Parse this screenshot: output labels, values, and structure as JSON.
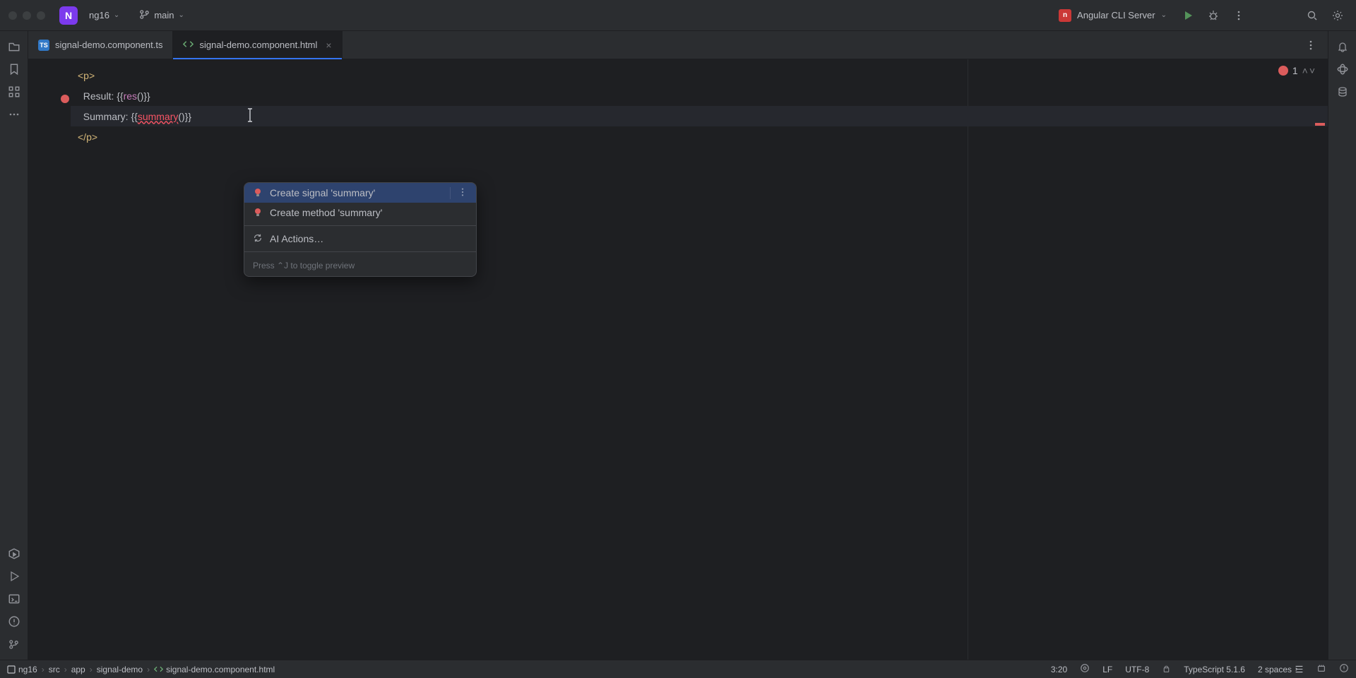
{
  "titlebar": {
    "project_letter": "N",
    "project_name": "ng16",
    "branch_name": "main",
    "run_config": "Angular CLI Server"
  },
  "tabs": [
    {
      "label": "signal-demo.component.ts",
      "type": "ts"
    },
    {
      "label": "signal-demo.component.html",
      "type": "html",
      "active": true
    }
  ],
  "code": {
    "line1_open": "<p>",
    "line2_prefix": "  Result: {{",
    "line2_fn": "res",
    "line2_suffix": "()}}",
    "line3_prefix": "  Summary: {{",
    "line3_fn": "summary",
    "line3_suffix": "()}}",
    "line4_close": "</p>"
  },
  "inspections": {
    "error_count": "1"
  },
  "intentions": {
    "items": [
      {
        "label": "Create signal 'summary'",
        "icon": "bulb-red",
        "selected": true
      },
      {
        "label": "Create method 'summary'",
        "icon": "bulb-red"
      }
    ],
    "ai_label": "AI Actions…",
    "hint": "Press ⌃J to toggle preview"
  },
  "breadcrumbs": [
    "ng16",
    "src",
    "app",
    "signal-demo",
    "signal-demo.component.html"
  ],
  "status": {
    "position": "3:20",
    "line_sep": "LF",
    "encoding": "UTF-8",
    "language": "TypeScript 5.1.6",
    "indent": "2 spaces"
  }
}
